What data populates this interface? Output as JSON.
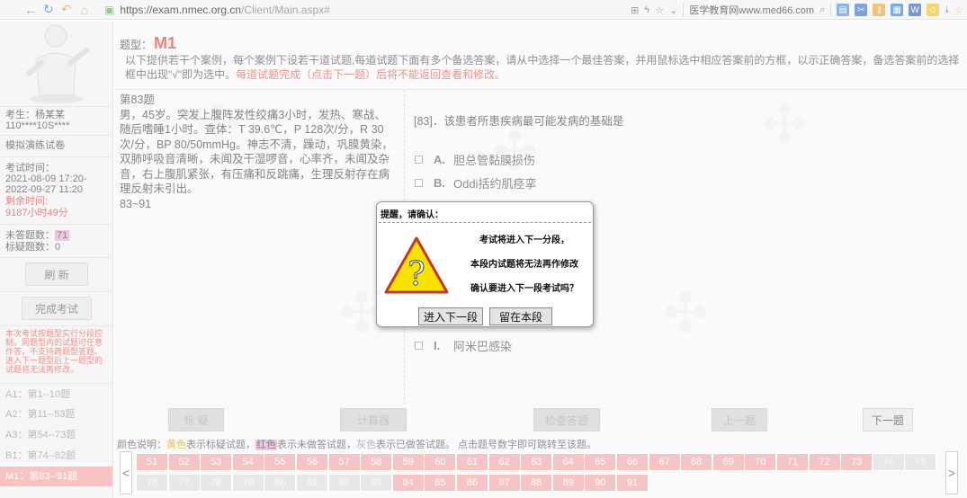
{
  "browser": {
    "url_host": "https://exam.nmec.org.cn",
    "url_path": "/Client/Main.aspx#",
    "bookmark": "医学教育网www.med66.com"
  },
  "sidebar": {
    "examinee_label": "考生：杨某某",
    "examinee_id": "110****10S****",
    "paper_name": "模拟演练试卷",
    "exam_time_label": "考试时间：",
    "time_start": "2021-08-09 17:20-",
    "time_end": "2022-09-27 11:20",
    "remaining_label": "剩余时间:",
    "remaining_value": "9187小时49分",
    "unanswered_label": "未答题数：",
    "unanswered_value": "71",
    "marked_label": "标疑题数：",
    "marked_value": "0",
    "refresh_btn": "刷 新",
    "finish_btn": "完成考试",
    "note": "本次考试按题型实行分段控制，同题型内的试题可任意作答，不支持跨题型答题。进入下一题型后上一题型的试题将无法再修改。",
    "sections": [
      {
        "label": "A1：第1--10题",
        "active": false
      },
      {
        "label": "A2：第11--53题",
        "active": false
      },
      {
        "label": "A3：第54--73题",
        "active": false
      },
      {
        "label": "B1：第74--82题",
        "active": false
      },
      {
        "label": "M1：第83--91题",
        "active": true
      }
    ]
  },
  "main": {
    "qtype_label": "题型：",
    "qtype_code": "M1",
    "instruction": "以下提供若干个案例，每个案例下设若干道试题,每道试题下面有多个备选答案，请从中选择一个最佳答案，并用鼠标选中相应答案前的方框，以示正确答案，备选答案前的选择框中出现\"√\"即为选中。",
    "instruction_warn": "每道试题完成（点击下一题）后将不能返回查看和修改。",
    "stem_title": "第83题",
    "stem_text": "男，45岁。突发上腹阵发性绞痛3小时，发热、寒战、随后嗜睡1小时。查体：T 39.6℃，P 128次/分，R 30次/分，BP 80/50mmHg。神志不清，躁动，巩膜黄染，双肺呼吸音清晰，未闻及干湿啰音，心率齐，未闻及杂音，右上腹肌紧张，有压痛和反跳痛，生理反射存在病理反射未引出。",
    "stem_range": "83~91",
    "question": "[83]．该患者所患疾病最可能发病的基础是",
    "options": [
      {
        "letter": "A.",
        "text": "胆总管黏膜损伤"
      },
      {
        "letter": "B.",
        "text": "Oddi括约肌痉挛"
      },
      {
        "letter": "I.",
        "text": "阿米巴感染"
      }
    ]
  },
  "nav": {
    "btn_mark": "标 疑",
    "btn_calc": "计算器",
    "btn_review": "检查答题",
    "btn_prev": "上一题",
    "btn_next": "下一题"
  },
  "legend": {
    "prefix": "颜色说明：",
    "yellow": "黄色",
    "yellow_desc": "表示标疑试题，",
    "pink": "红色",
    "pink_desc": "表示未做答试题，",
    "gray": "灰色",
    "gray_desc": "表示已做答试题。 点击题号数字即可跳转至该题。"
  },
  "grid": {
    "row1": [
      "51",
      "52",
      "53",
      "54",
      "55",
      "56",
      "57",
      "58",
      "59",
      "60",
      "61",
      "62",
      "63",
      "64",
      "65",
      "66",
      "67",
      "68",
      "69",
      "70",
      "71",
      "72",
      "73",
      "74",
      "75"
    ],
    "row1_unanswered_until": 23,
    "row2": [
      "76",
      "77",
      "78",
      "79",
      "80",
      "81",
      "82",
      "83",
      "84",
      "85",
      "86",
      "87",
      "88",
      "89",
      "90",
      "91"
    ],
    "row2_unanswered_from": 8,
    "prev_arrow": "<",
    "next_arrow": ">"
  },
  "dialog": {
    "title": "提醒，请确认：",
    "line1": "考试将进入下一分段，",
    "line2": "本段内试题将无法再作修改",
    "line3": "确认要进入下一段考试吗？",
    "confirm_btn": "进入下一段",
    "stay_btn": "留在本段"
  }
}
